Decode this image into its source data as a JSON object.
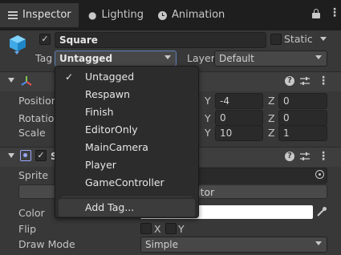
{
  "tabs": [
    {
      "label": "Inspector"
    },
    {
      "label": "Lighting"
    },
    {
      "label": "Animation"
    }
  ],
  "gameobject": {
    "name": "Square",
    "static_label": "Static",
    "tag_label": "Tag",
    "tag_value": "Untagged",
    "layer_label": "Layer",
    "layer_value": "Default"
  },
  "transform": {
    "rows": [
      {
        "label": "Position",
        "y_label": "Y",
        "y": "-4",
        "z_label": "Z",
        "z": "0"
      },
      {
        "label": "Rotation",
        "y_label": "Y",
        "y": "0",
        "z_label": "Z",
        "z": "0"
      },
      {
        "label": "Scale",
        "y_label": "Y",
        "y": "10",
        "z_label": "Z",
        "z": "1"
      }
    ]
  },
  "sprite_renderer": {
    "title_initial": "S",
    "sprite_label": "Sprite",
    "edit_button_partial": "itor",
    "color_label": "Color",
    "flip_label": "Flip",
    "flip_x": "X",
    "flip_y": "Y",
    "draw_mode_label": "Draw Mode",
    "draw_mode_value": "Simple"
  },
  "tag_menu": {
    "items": [
      {
        "label": "Untagged",
        "checked": true
      },
      {
        "label": "Respawn"
      },
      {
        "label": "Finish"
      },
      {
        "label": "EditorOnly"
      },
      {
        "label": "MainCamera"
      },
      {
        "label": "Player"
      },
      {
        "label": "GameController"
      }
    ],
    "add_tag": "Add Tag..."
  },
  "icons": [
    "cube-icon",
    "lightbulb-icon",
    "clock-icon",
    "lock-icon",
    "more-vertical-icon",
    "help-icon",
    "sliders-icon",
    "transform-icon",
    "sprite-renderer-icon",
    "eyedropper-icon",
    "object-picker-icon"
  ],
  "colors": {
    "panel": "#383838",
    "tabbar": "#1e1e1e",
    "field": "#2a2a2a",
    "menu": "#2c2c2c",
    "menu_highlight": "#3c3c3c"
  }
}
